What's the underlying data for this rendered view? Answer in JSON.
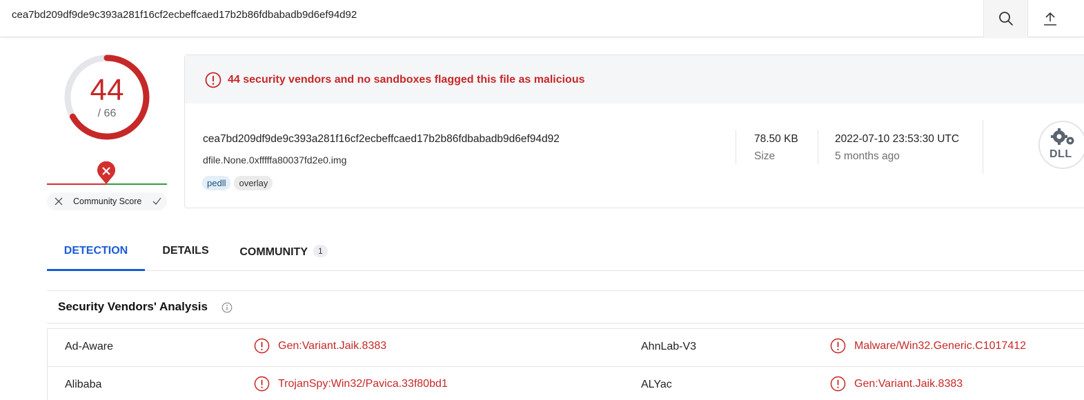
{
  "topbar": {
    "search_value": "cea7bd209df9de9c393a281f16cf2ecbeffcaed17b2b86fdbabadb9d6ef94d92"
  },
  "score": {
    "detections": "44",
    "total": "/ 66",
    "fraction": 0.667,
    "color": "#c62828"
  },
  "community": {
    "label": "Community Score"
  },
  "summary": {
    "alert_text": "44 security vendors and no sandboxes flagged this file as malicious",
    "hash": "cea7bd209df9de9c393a281f16cf2ecbeffcaed17b2b86fdbabadb9d6ef94d92",
    "filename": "dfile.None.0xfffffa80037fd2e0.img",
    "tags": [
      "pedll",
      "overlay"
    ],
    "size_value": "78.50 KB",
    "size_label": "Size",
    "date_value": "2022-07-10 23:53:30 UTC",
    "date_ago": "5 months ago",
    "file_type": "DLL"
  },
  "tabs": [
    {
      "label": "DETECTION"
    },
    {
      "label": "DETAILS"
    },
    {
      "label": "COMMUNITY",
      "badge": "1"
    }
  ],
  "analysis": {
    "title": "Security Vendors' Analysis",
    "rows": [
      {
        "left_vendor": "Ad-Aware",
        "left_result": "Gen:Variant.Jaik.8383",
        "right_vendor": "AhnLab-V3",
        "right_result": "Malware/Win32.Generic.C1017412"
      },
      {
        "left_vendor": "Alibaba",
        "left_result": "TrojanSpy:Win32/Pavica.33f80bd1",
        "right_vendor": "ALYac",
        "right_result": "Gen:Variant.Jaik.8383"
      }
    ]
  },
  "icons": {
    "search": "search-icon",
    "upload": "upload-icon",
    "alert": "alert-circle-icon",
    "info": "info-icon",
    "close": "close-icon",
    "check": "check-icon",
    "file_type": "gears-icon"
  }
}
